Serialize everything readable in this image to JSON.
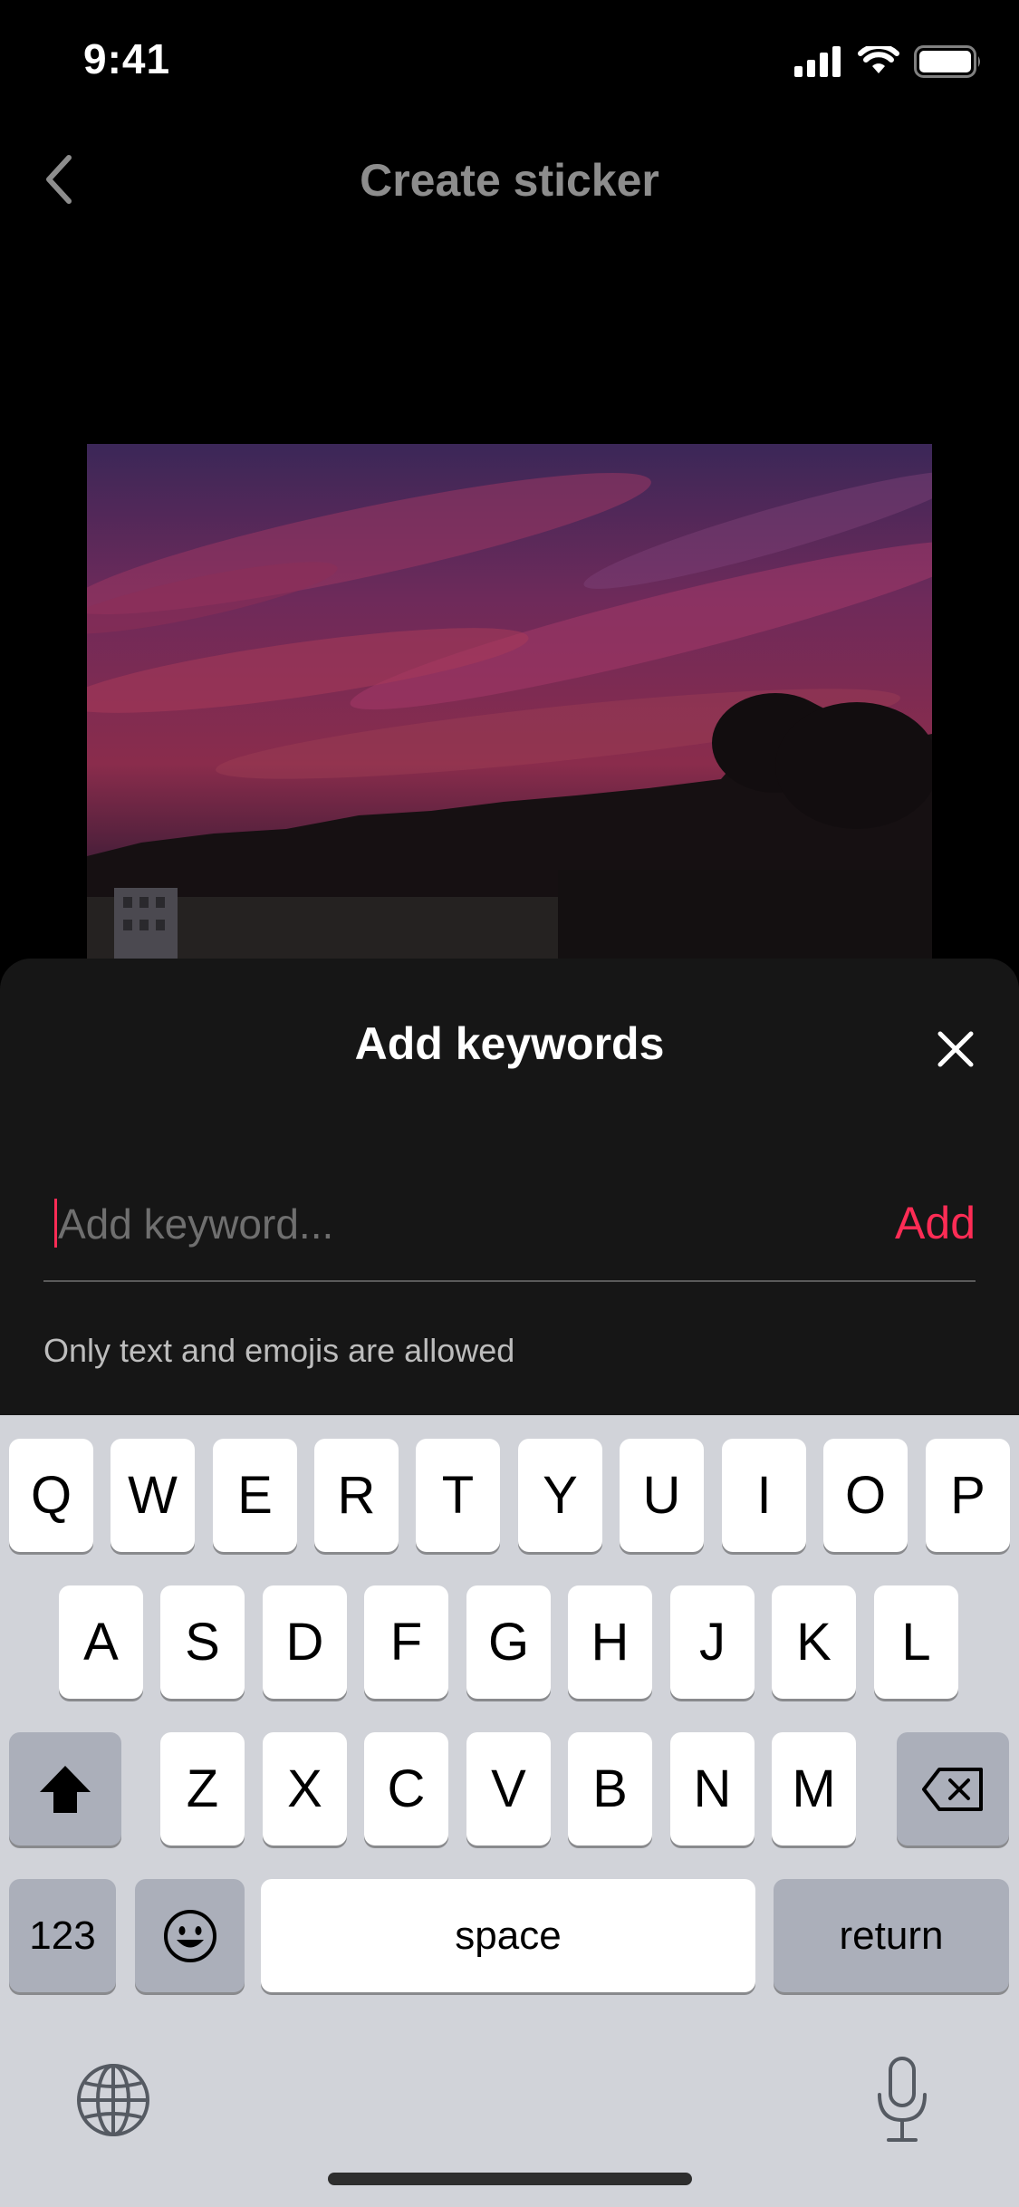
{
  "status_bar": {
    "time": "9:41"
  },
  "nav": {
    "title": "Create sticker"
  },
  "sheet": {
    "title": "Add keywords",
    "input_placeholder": "Add keyword...",
    "add_label": "Add",
    "helper_text": "Only text and emojis are allowed"
  },
  "keyboard": {
    "row1": [
      "Q",
      "W",
      "E",
      "R",
      "T",
      "Y",
      "U",
      "I",
      "O",
      "P"
    ],
    "row2": [
      "A",
      "S",
      "D",
      "F",
      "G",
      "H",
      "J",
      "K",
      "L"
    ],
    "row3": [
      "Z",
      "X",
      "C",
      "V",
      "B",
      "N",
      "M"
    ],
    "numbers_label": "123",
    "space_label": "space",
    "return_label": "return"
  },
  "colors": {
    "accent": "#fe2c55",
    "sheet_bg": "#161616",
    "keyboard_bg": "#d1d3d9"
  },
  "icons": [
    "signal-icon",
    "wifi-icon",
    "battery-icon",
    "back-chevron-icon",
    "close-icon",
    "shift-icon",
    "backspace-icon",
    "emoji-icon",
    "globe-icon",
    "microphone-icon"
  ]
}
